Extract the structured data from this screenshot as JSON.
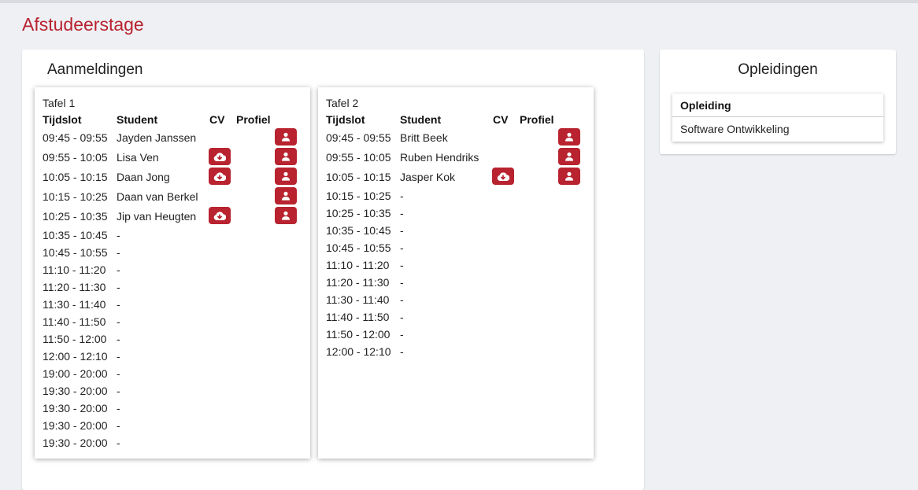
{
  "page": {
    "title": "Afstudeerstage"
  },
  "aanmeldingen": {
    "title": "Aanmeldingen",
    "headers": {
      "tijdslot": "Tijdslot",
      "student": "Student",
      "cv": "CV",
      "profiel": "Profiel"
    },
    "tafels": [
      {
        "name": "Tafel 1",
        "rows": [
          {
            "slot": "09:45 - 09:55",
            "student": "Jayden Janssen",
            "cv": false,
            "profiel": true
          },
          {
            "slot": "09:55 - 10:05",
            "student": "Lisa Ven",
            "cv": true,
            "profiel": true
          },
          {
            "slot": "10:05 - 10:15",
            "student": "Daan Jong",
            "cv": true,
            "profiel": true
          },
          {
            "slot": "10:15 - 10:25",
            "student": "Daan van Berkel",
            "cv": false,
            "profiel": true
          },
          {
            "slot": "10:25 - 10:35",
            "student": "Jip van Heugten",
            "cv": true,
            "profiel": true
          },
          {
            "slot": "10:35 - 10:45",
            "student": "-",
            "cv": false,
            "profiel": false
          },
          {
            "slot": "10:45 - 10:55",
            "student": "-",
            "cv": false,
            "profiel": false
          },
          {
            "slot": "11:10 - 11:20",
            "student": "-",
            "cv": false,
            "profiel": false
          },
          {
            "slot": "11:20 - 11:30",
            "student": "-",
            "cv": false,
            "profiel": false
          },
          {
            "slot": "11:30 - 11:40",
            "student": "-",
            "cv": false,
            "profiel": false
          },
          {
            "slot": "11:40 - 11:50",
            "student": "-",
            "cv": false,
            "profiel": false
          },
          {
            "slot": "11:50 - 12:00",
            "student": "-",
            "cv": false,
            "profiel": false
          },
          {
            "slot": "12:00 - 12:10",
            "student": "-",
            "cv": false,
            "profiel": false
          },
          {
            "slot": "19:00 - 20:00",
            "student": "-",
            "cv": false,
            "profiel": false
          },
          {
            "slot": "19:30 - 20:00",
            "student": "-",
            "cv": false,
            "profiel": false
          },
          {
            "slot": "19:30 - 20:00",
            "student": "-",
            "cv": false,
            "profiel": false
          },
          {
            "slot": "19:30 - 20:00",
            "student": "-",
            "cv": false,
            "profiel": false
          },
          {
            "slot": "19:30 - 20:00",
            "student": "-",
            "cv": false,
            "profiel": false
          }
        ]
      },
      {
        "name": "Tafel 2",
        "rows": [
          {
            "slot": "09:45 - 09:55",
            "student": "Britt Beek",
            "cv": false,
            "profiel": true
          },
          {
            "slot": "09:55 - 10:05",
            "student": "Ruben Hendriks",
            "cv": false,
            "profiel": true
          },
          {
            "slot": "10:05 - 10:15",
            "student": "Jasper Kok",
            "cv": true,
            "profiel": true
          },
          {
            "slot": "10:15 - 10:25",
            "student": "-",
            "cv": false,
            "profiel": false
          },
          {
            "slot": "10:25 - 10:35",
            "student": "-",
            "cv": false,
            "profiel": false
          },
          {
            "slot": "10:35 - 10:45",
            "student": "-",
            "cv": false,
            "profiel": false
          },
          {
            "slot": "10:45 - 10:55",
            "student": "-",
            "cv": false,
            "profiel": false
          },
          {
            "slot": "11:10 - 11:20",
            "student": "-",
            "cv": false,
            "profiel": false
          },
          {
            "slot": "11:20 - 11:30",
            "student": "-",
            "cv": false,
            "profiel": false
          },
          {
            "slot": "11:30 - 11:40",
            "student": "-",
            "cv": false,
            "profiel": false
          },
          {
            "slot": "11:40 - 11:50",
            "student": "-",
            "cv": false,
            "profiel": false
          },
          {
            "slot": "11:50 - 12:00",
            "student": "-",
            "cv": false,
            "profiel": false
          },
          {
            "slot": "12:00 - 12:10",
            "student": "-",
            "cv": false,
            "profiel": false
          }
        ]
      }
    ]
  },
  "opleidingen": {
    "title": "Opleidingen",
    "header": "Opleiding",
    "items": [
      "Software Ontwikkeling"
    ]
  },
  "icons": {
    "cv": "cloud-download-icon",
    "profiel": "user-icon"
  },
  "colors": {
    "accent": "#b8232f",
    "background": "#eef0f4"
  }
}
